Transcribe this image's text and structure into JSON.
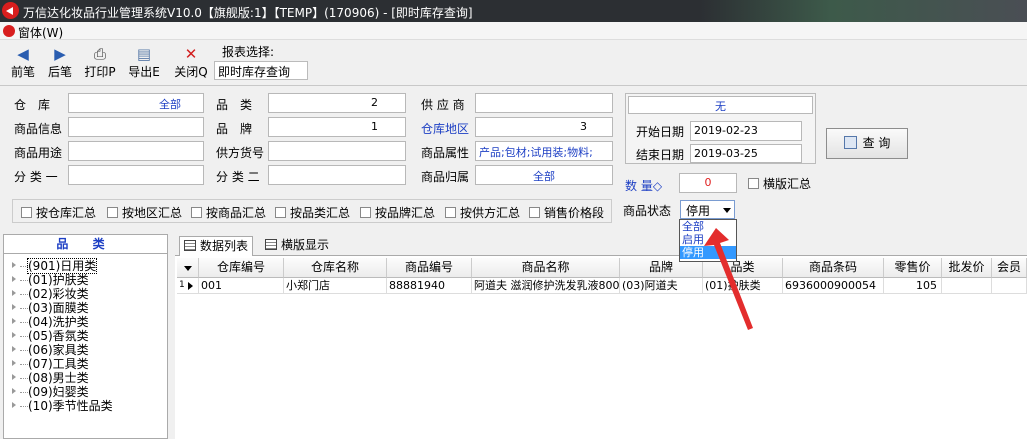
{
  "window": {
    "title": "万信达化妆品行业管理系统V10.0【旗舰版:1】【TEMP】(170906) - [即时库存查询]"
  },
  "menu": {
    "window_label": "窗体(W)"
  },
  "toolbar": {
    "prev_label": "前笔",
    "next_label": "后笔",
    "print_label": "打印P",
    "export_label": "导出E",
    "close_label": "关闭Q",
    "report_select_label": "报表选择:",
    "report_value": "即时库存查询"
  },
  "filters": {
    "warehouse_label": "仓　库",
    "warehouse_value": "全部",
    "product_info_label": "商品信息",
    "product_use_label": "商品用途",
    "class1_label": "分 类 一",
    "category_label": "品　类",
    "category_value": "2",
    "brand_label": "品　牌",
    "brand_value": "1",
    "supplier_code_label": "供方货号",
    "class2_label": "分 类 二",
    "supplier_label": "供 应 商",
    "warehouse_region_label": "仓库地区",
    "warehouse_region_value": "3",
    "product_attr_label": "商品属性",
    "product_attr_value": "产品;包材;试用装;物料;",
    "product_owner_label": "商品归属",
    "product_owner_value": "全部",
    "date_status": "无",
    "start_date_label": "开始日期",
    "start_date_value": "2019-02-23",
    "end_date_label": "结束日期",
    "end_date_value": "2019-03-25",
    "query_label": "查 询",
    "qty_label": "数 量◇",
    "qty_value": "0",
    "horizontal_summary_label": "横版汇总",
    "status_label": "商品状态",
    "status_value": "停用",
    "status_options": [
      "全部",
      "启用",
      "停用"
    ],
    "summary_checkboxes": [
      "按仓库汇总",
      "按地区汇总",
      "按商品汇总",
      "按品类汇总",
      "按品牌汇总",
      "按供方汇总",
      "销售价格段"
    ]
  },
  "tree": {
    "header": "品 类",
    "items": [
      "(901)日用类",
      "(01)护肤类",
      "(02)彩妆类",
      "(03)面膜类",
      "(04)洗护类",
      "(05)香氛类",
      "(06)家具类",
      "(07)工具类",
      "(08)男士类",
      "(09)妇婴类",
      "(10)季节性品类"
    ]
  },
  "tabs": {
    "list_label": "数据列表",
    "horizontal_label": "横版显示"
  },
  "grid": {
    "columns": [
      "仓库编号",
      "仓库名称",
      "商品编号",
      "商品名称",
      "品牌",
      "品类",
      "商品条码",
      "零售价",
      "批发价",
      "会员"
    ],
    "rows": [
      {
        "index": "1",
        "cells": [
          "001",
          "小郑门店",
          "88881940",
          "阿道夫 滋润修护洗发乳液800",
          "(03)阿道夫",
          "(01)护肤类",
          "6936000900054",
          "105",
          "",
          ""
        ]
      }
    ]
  }
}
